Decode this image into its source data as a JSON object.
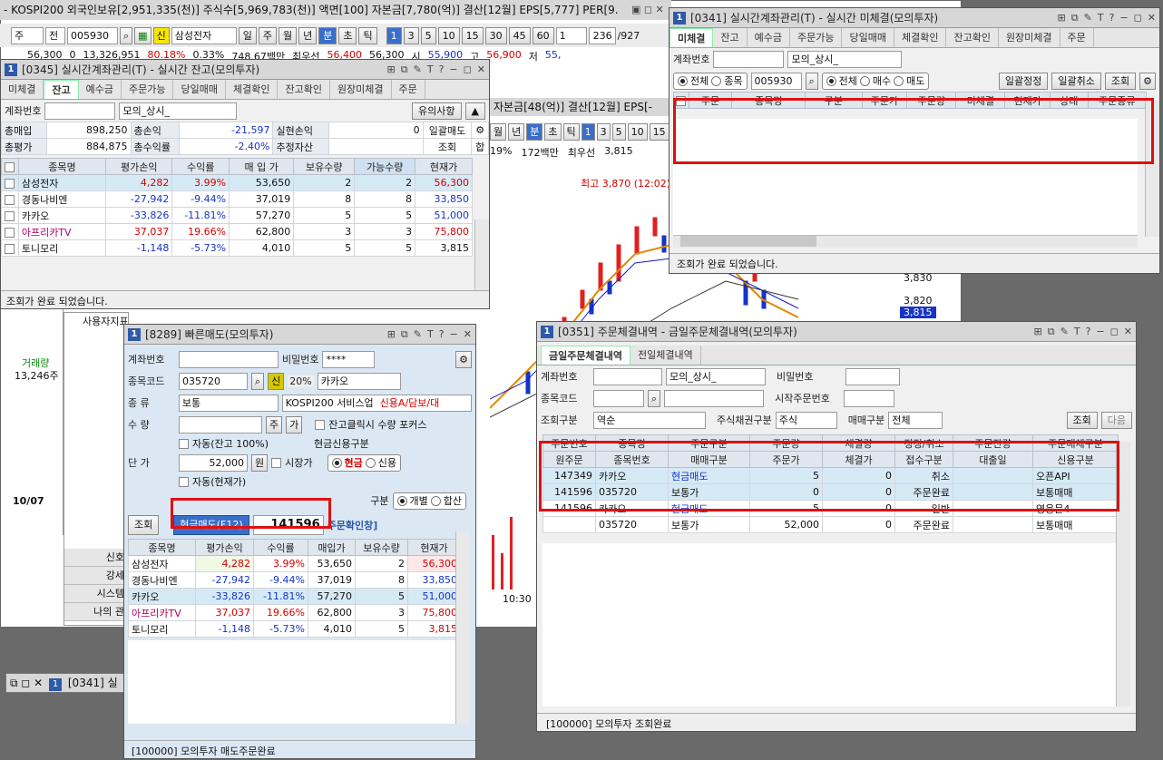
{
  "top_ticker": "- KOSPI200 외국인보유[2,951,335(천)] 주식수[5,969,783(천)] 액면[100] 자본금[7,780(억)] 결산[12월] EPS[5,777] PER[9.",
  "chart_toolbar": {
    "mode": "주",
    "type": "전",
    "code": "005930",
    "stock": "삼성전자",
    "periods": [
      "일",
      "주",
      "월",
      "년",
      "분",
      "초",
      "틱"
    ],
    "minutes": [
      "1",
      "3",
      "5",
      "10",
      "15",
      "30",
      "45",
      "60"
    ],
    "count": "1",
    "page": "236",
    "total": "/927"
  },
  "bg_row": {
    "a": "56,300",
    "b": "0",
    "c": "13,326,951",
    "d": "80.18%",
    "e": "0.33%",
    "f": "748.67백만",
    "g": "최우선",
    "h": "56,400",
    "i": "56,300",
    "j": "시",
    "k": "55,900",
    "l": "고",
    "m": "56,900",
    "n": "저",
    "o": "55,"
  },
  "chart_mid": {
    "info": "자본금[48(억)] 결산[12월] EPS[-",
    "periods": [
      "월",
      "년",
      "분",
      "초",
      "틱"
    ],
    "minutes": [
      "1",
      "3",
      "5",
      "10",
      "15"
    ],
    "pct": "19%",
    "vol": "172백만",
    "best_label": "최우선",
    "best": "3,815",
    "high": "최고 3,870 (12:02)",
    "y1": "3,830",
    "y2": "3,820",
    "y3": "3,815",
    "time": "10:30"
  },
  "left_chart": {
    "vol_label": "거래량",
    "vol": "13,246주",
    "date": "10/07"
  },
  "side_menu": {
    "user_title": "사용자지표",
    "items": [
      "신호",
      "강세",
      "시스템",
      "나의 관"
    ]
  },
  "win0345": {
    "num": "1",
    "title": "[0345] 실시간계좌관리(T) - 실시간 잔고(모의투자)",
    "tabs": [
      "미체결",
      "잔고",
      "예수금",
      "주문가능",
      "당일매매",
      "체결확인",
      "잔고확인",
      "원장미체결",
      "주문"
    ],
    "acct_label": "계좌번호",
    "acct_name": "모의_상시_",
    "warn_btn": "유의사항",
    "sum": {
      "buy_label": "총매입",
      "buy": "898,250",
      "loss_label": "총손익",
      "loss": "-21,597",
      "real_label": "실현손익",
      "real": "0",
      "bulk": "일괄매도",
      "eval_label": "총평가",
      "eval": "884,875",
      "rate_label": "총수익률",
      "rate": "-2.40%",
      "est_label": "추정자산",
      "query": "조회",
      "sum_btn": "합"
    },
    "cols": [
      "종목명",
      "평가손익",
      "수익률",
      "매 입 가",
      "보유수량",
      "가능수량",
      "현재가"
    ],
    "rows": [
      [
        "삼성전자",
        "4,282",
        "3.99%",
        "53,650",
        "2",
        "2",
        "56,300"
      ],
      [
        "경동나비엔",
        "-27,942",
        "-9.44%",
        "37,019",
        "8",
        "8",
        "33,850"
      ],
      [
        "카카오",
        "-33,826",
        "-11.81%",
        "57,270",
        "5",
        "5",
        "51,000"
      ],
      [
        "아프리카TV",
        "37,037",
        "19.66%",
        "62,800",
        "3",
        "3",
        "75,800"
      ],
      [
        "토니모리",
        "-1,148",
        "-5.73%",
        "4,010",
        "5",
        "5",
        "3,815"
      ]
    ],
    "status": "조회가 완료 되었습니다."
  },
  "win0341": {
    "num": "1",
    "title": "[0341] 실시간계좌관리(T) - 실시간 미체결(모의투자)",
    "tabs": [
      "미체결",
      "잔고",
      "예수금",
      "주문가능",
      "당일매매",
      "체결확인",
      "잔고확인",
      "원장미체결",
      "주문"
    ],
    "acct_label": "계좌번호",
    "acct_name": "모의_상시_",
    "r1": "전체",
    "r2": "종목",
    "code": "005930",
    "r3": "전체",
    "r4": "매수",
    "r5": "매도",
    "btn1": "일괄정정",
    "btn2": "일괄취소",
    "btn3": "조회",
    "cols": [
      "주문",
      "종목명",
      "구분",
      "주문가",
      "주문량",
      "미체결",
      "현재가",
      "상태",
      "주문종류"
    ],
    "status": "조회가 완료 되었습니다."
  },
  "win8289": {
    "num": "1",
    "title": "[8289] 빠른매도(모의투자)",
    "acct_label": "계좌번호",
    "pw_label": "비밀번호",
    "pw": "****",
    "code_label": "종목코드",
    "code": "035720",
    "credit_mark": "신",
    "pct": "20%",
    "stock": "카카오",
    "kind_label": "종 류",
    "kind": "보통",
    "market": "KOSPI200 서비스업",
    "credit_info": "신용A/담보/대",
    "qty_label": "수 량",
    "qty_btn1": "주",
    "qty_btn2": "가",
    "chk1": "잔고클릭시 수량 포커스",
    "chk2": "자동(잔고 100%)",
    "price_label": "단 가",
    "price": "52,000",
    "won": "원",
    "chk3": "시장가",
    "chk4": "자동(현재가)",
    "cash_credit": "현금신용구분",
    "cash": "현금",
    "credit": "신용",
    "gubun_label": "구분",
    "indiv": "개별",
    "sum": "합산",
    "query": "조회",
    "sell_btn": "현금매도(F12)",
    "order_no": "141596",
    "confirm": "주문확인창]",
    "cols": [
      "종목명",
      "평가손익",
      "수익률",
      "매입가",
      "보유수량",
      "현재가"
    ],
    "rows": [
      [
        "삼성전자",
        "4,282",
        "3.99%",
        "53,650",
        "2",
        "56,300"
      ],
      [
        "경동나비엔",
        "-27,942",
        "-9.44%",
        "37,019",
        "8",
        "33,850"
      ],
      [
        "카카오",
        "-33,826",
        "-11.81%",
        "57,270",
        "5",
        "51,000"
      ],
      [
        "아프리카TV",
        "37,037",
        "19.66%",
        "62,800",
        "3",
        "75,800"
      ],
      [
        "토니모리",
        "-1,148",
        "-5.73%",
        "4,010",
        "5",
        "3,815"
      ]
    ],
    "status": "[100000] 모의투자 매도주문완료"
  },
  "win0351": {
    "num": "1",
    "title": "[0351] 주문체결내역 - 금일주문체결내역(모의투자)",
    "tabs": [
      "금일주문체결내역",
      "전일체결내역"
    ],
    "acct_label": "계좌번호",
    "acct_name": "모의_상시_",
    "pw_label": "비밀번호",
    "code_label": "종목코드",
    "start_label": "시작주문번호",
    "q_label": "조회구분",
    "q_val": "역순",
    "bond_label": "주식채권구분",
    "bond_val": "주식",
    "trade_label": "매매구분",
    "trade_val": "전체",
    "query": "조회",
    "next": "다음",
    "h1": [
      "주문번호",
      "종목명",
      "주문구분",
      "주문량",
      "체결량",
      "정정/취소",
      "주문잔량",
      "주문매체구분"
    ],
    "h2": [
      "원주문",
      "종목번호",
      "매매구분",
      "주문가",
      "체결가",
      "접수구분",
      "대출일",
      "신용구분"
    ],
    "rows": [
      {
        "a": [
          "147349",
          "카카오",
          "현금매도",
          "5",
          "0",
          "취소",
          "",
          "오픈API"
        ],
        "b": [
          "141596",
          "035720",
          "보통가",
          "0",
          "0",
          "주문완료",
          "",
          "보통매매"
        ]
      },
      {
        "a": [
          "141596",
          "카카오",
          "현금매도",
          "5",
          "0",
          "일반",
          "",
          "영웅문4"
        ],
        "b": [
          "",
          "035720",
          "보통가",
          "52,000",
          "0",
          "주문완료",
          "",
          "보통매매"
        ]
      }
    ],
    "status": "[100000] 모의투자 조회완료"
  },
  "taskbar": {
    "item": "[0341] 실"
  }
}
